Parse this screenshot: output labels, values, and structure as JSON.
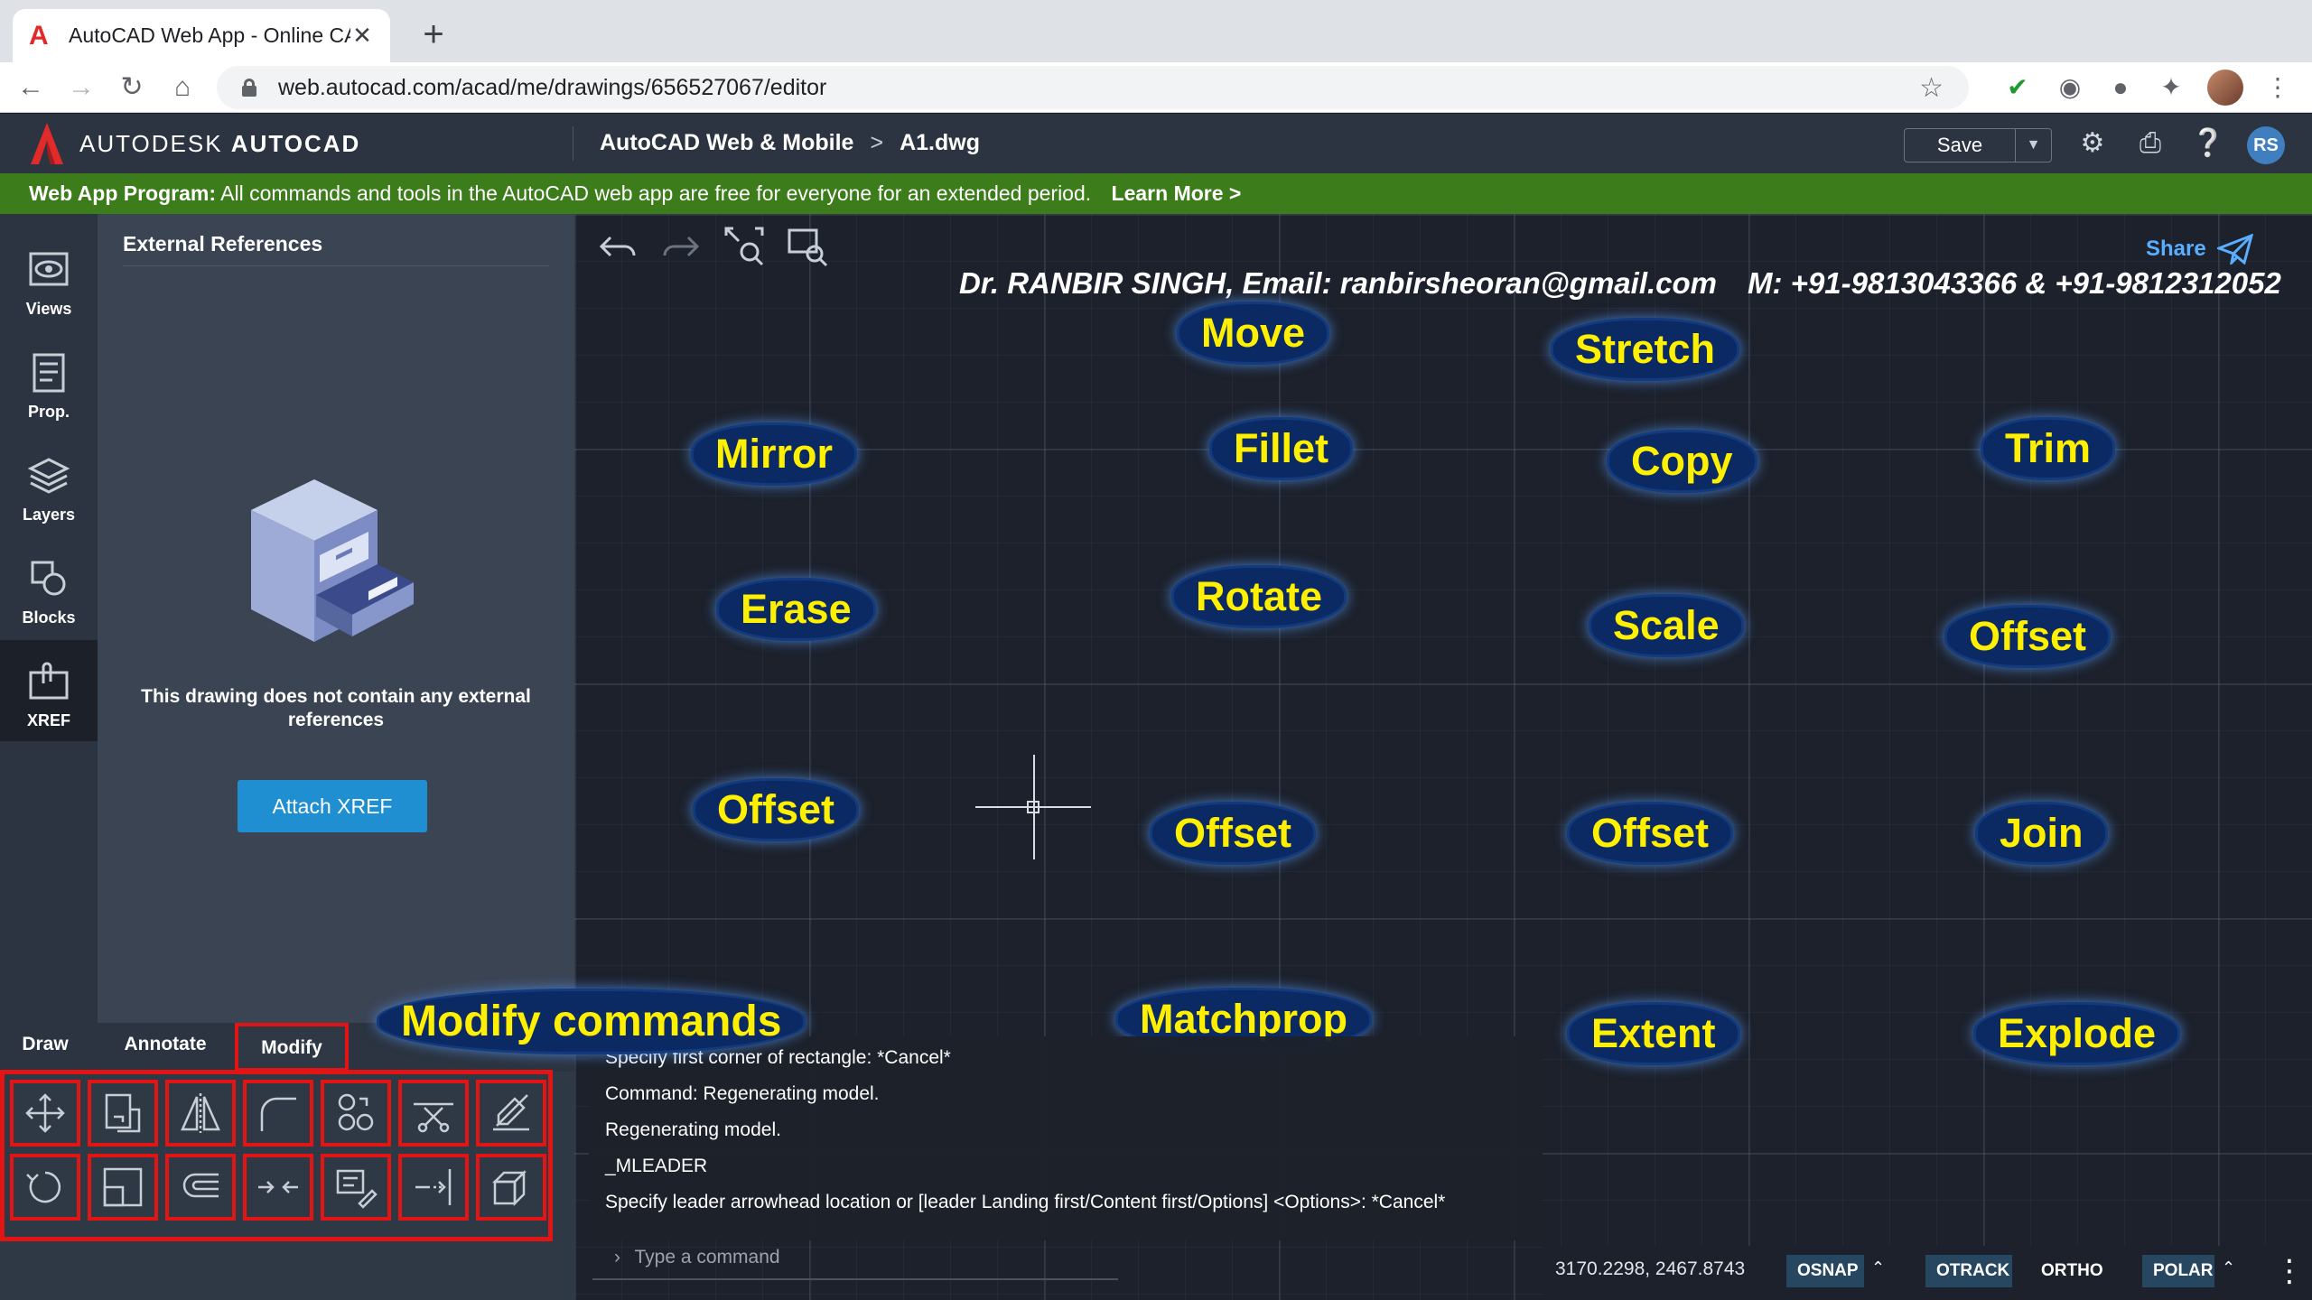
{
  "browser": {
    "tab_title": "AutoCAD Web App - Online CA",
    "tab_close": "✕",
    "new_tab": "+",
    "url": "web.autocad.com/acad/me/drawings/656527067/editor"
  },
  "header": {
    "brand_light": "AUTODESK",
    "brand_bold": "AUTOCAD",
    "breadcrumb_app": "AutoCAD Web & Mobile",
    "breadcrumb_sep": ">",
    "breadcrumb_file": "A1.dwg",
    "save_label": "Save",
    "avatar_initials": "RS"
  },
  "banner": {
    "lead": "Web App Program:",
    "text": "All commands and tools in the AutoCAD web app are free for everyone for an extended period.",
    "link": "Learn More >"
  },
  "rail": {
    "items": [
      {
        "label": "Views",
        "icon": "eye-icon"
      },
      {
        "label": "Prop.",
        "icon": "properties-icon"
      },
      {
        "label": "Layers",
        "icon": "layers-icon"
      },
      {
        "label": "Blocks",
        "icon": "blocks-icon"
      },
      {
        "label": "XREF",
        "icon": "xref-icon"
      }
    ]
  },
  "panel": {
    "title": "External References",
    "empty_message": "This drawing does not contain any external references",
    "attach_button": "Attach XREF"
  },
  "tool_tabs": [
    "Draw",
    "Annotate",
    "Modify"
  ],
  "selected_tool_tab": "Modify",
  "tools": [
    "move-tool",
    "copy-tool",
    "mirror-tool",
    "fillet-tool",
    "array-tool",
    "trim-tool",
    "erase-tool",
    "rotate-tool",
    "scale-tool",
    "offset-tool",
    "join-tool",
    "matchprop-tool",
    "extend-tool",
    "explode-tool"
  ],
  "canvas": {
    "share_label": "Share",
    "author_line_1": "Dr. RANBIR SINGH, Email: ranbirsheoran@gmail.com",
    "author_line_2": "M: +91-9813043366  & +91-9812312052",
    "labels": {
      "move": "Move",
      "stretch": "Stretch",
      "mirror": "Mirror",
      "fillet": "Fillet",
      "copy": "Copy",
      "trim": "Trim",
      "erase": "Erase",
      "rotate": "Rotate",
      "scale": "Scale",
      "offset_a": "Offset",
      "offset_b": "Offset",
      "offset_c": "Offset",
      "offset_d": "Offset",
      "join": "Join",
      "modify_commands": "Modify commands",
      "matchprop": "Matchprop",
      "extent": "Extent",
      "explode": "Explode"
    }
  },
  "command_line": {
    "history": [
      "Specify first corner of rectangle: *Cancel*",
      "Command: Regenerating model.",
      "Regenerating model.",
      "_MLEADER",
      "Specify leader arrowhead location or [leader Landing first/Content first/Options] <Options>: *Cancel*"
    ],
    "placeholder": "Type a command"
  },
  "status_bar": {
    "coordinates": "3170.2298, 2467.8743",
    "osnap": "OSNAP",
    "otrack": "OTRACK",
    "ortho": "ORTHO",
    "polar": "POLAR"
  },
  "colors": {
    "banner": "#3d7c1a",
    "highlight": "#e21414",
    "label_text": "#ffef00",
    "label_bg": "#0b2a63",
    "accent": "#1f8fd1"
  }
}
